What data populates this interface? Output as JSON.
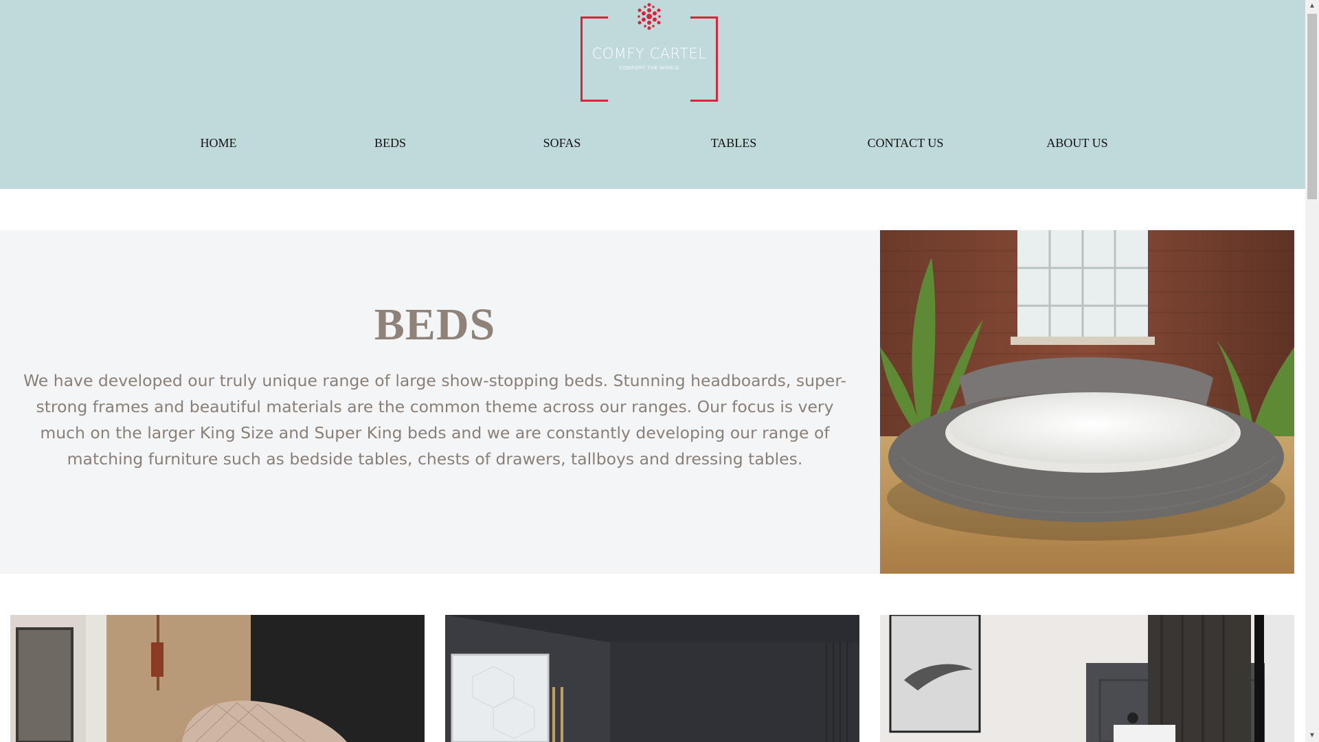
{
  "brand": {
    "name": "COMFY CARTEL",
    "tagline": "COMFORT THE WORLD",
    "accent_color": "#e0203a",
    "header_bg": "#c0dadb"
  },
  "nav": {
    "items": [
      {
        "label": "HOME"
      },
      {
        "label": "BEDS"
      },
      {
        "label": "SOFAS"
      },
      {
        "label": "TABLES"
      },
      {
        "label": "CONTACT US"
      },
      {
        "label": "ABOUT US"
      }
    ]
  },
  "hero": {
    "title": "BEDS",
    "text": "We have developed our truly unique range of large show-stopping beds. Stunning headboards, super-strong frames and beautiful materials are the common theme across our ranges. Our focus is very much on the larger King Size and Super King beds and we are constantly developing our range of matching furniture such as bedside tables, chests of drawers, tallboys and dressing tables.",
    "image_icon": "round-bed-photo"
  },
  "gallery": {
    "items": [
      {
        "icon": "bedroom-photo-quilted-headboard"
      },
      {
        "icon": "bedroom-photo-dark-wardrobe"
      },
      {
        "icon": "bedroom-photo-grey-panelled-wall"
      }
    ]
  },
  "scrollbar": {
    "up_glyph": "▲",
    "down_glyph": "▼"
  }
}
